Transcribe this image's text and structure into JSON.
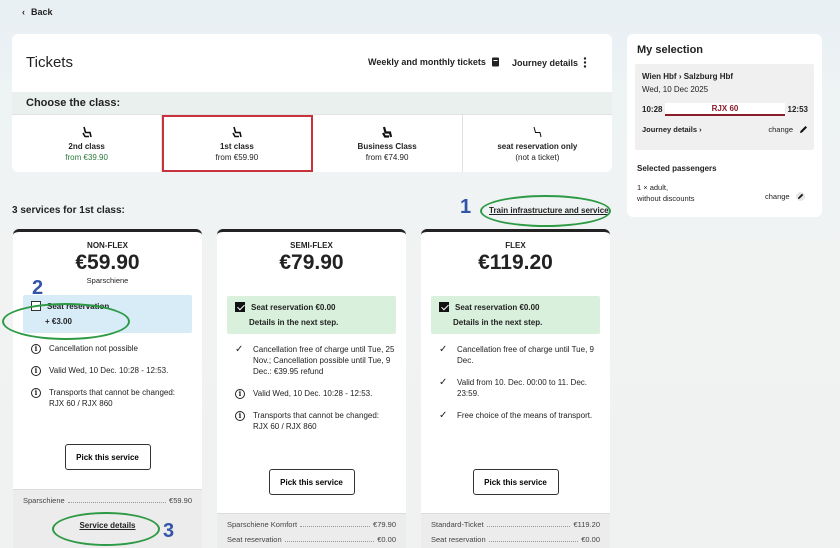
{
  "nav": {
    "back_label": "Back"
  },
  "header": {
    "title": "Tickets",
    "weekly_label": "Weekly and monthly tickets",
    "journey_label": "Journey details",
    "choose_class": "Choose the class:"
  },
  "classes": [
    {
      "name": "2nd class",
      "price": "from €39.90"
    },
    {
      "name": "1st class",
      "price": "from €59.90"
    },
    {
      "name": "Business Class",
      "price": "from €74.90"
    },
    {
      "name": "seat reservation only",
      "price": "(not a ticket)"
    }
  ],
  "services": {
    "heading": "3 services for 1st class:",
    "infra_link": "Train infrastructure and service",
    "annotations": [
      "1",
      "2",
      "3"
    ],
    "cards": [
      {
        "name": "NON-FLEX",
        "price": "€59.90",
        "sub": "Sparschiene",
        "reservation": "Seat reservation",
        "reservation_sub": "+ €3.00",
        "features": [
          "Cancellation not possible",
          "Valid Wed, 10 Dec. 10:28 - 12:53.",
          "Transports that cannot be changed: RJX 60 / RJX 860"
        ],
        "pick": "Pick this service",
        "foot": [
          {
            "label": "Sparschiene",
            "value": "€59.90"
          }
        ],
        "details": "Service details"
      },
      {
        "name": "SEMI-FLEX",
        "price": "€79.90",
        "sub": "",
        "reservation": "Seat reservation €0.00",
        "reservation_sub": "Details in the next step.",
        "features": [
          "Cancellation free of charge until Tue, 25 Nov.; Cancellation possible until Tue, 9 Dec.: €39.95 refund",
          "Valid Wed, 10 Dec. 10:28 - 12:53.",
          "Transports that cannot be changed: RJX 60 / RJX 860"
        ],
        "pick": "Pick this service",
        "foot": [
          {
            "label": "Sparschiene Komfort",
            "value": "€79.90"
          },
          {
            "label": "Seat reservation",
            "value": "€0.00"
          }
        ]
      },
      {
        "name": "FLEX",
        "price": "€119.20",
        "sub": "",
        "reservation": "Seat reservation €0.00",
        "reservation_sub": "Details in the next step.",
        "features": [
          "Cancellation free of charge until Tue, 9 Dec.",
          "Valid from 10. Dec. 00:00 to 11. Dec. 23:59.",
          "Free choice of the means of transport."
        ],
        "pick": "Pick this service",
        "foot": [
          {
            "label": "Standard-Ticket",
            "value": "€119.20"
          },
          {
            "label": "Seat reservation",
            "value": "€0.00"
          }
        ]
      }
    ]
  },
  "selection": {
    "title": "My selection",
    "route": "Wien Hbf › Salzburg Hbf",
    "date": "Wed, 10 Dec 2025",
    "dep": "10:28",
    "train": "RJX 60",
    "arr": "12:53",
    "journey_details": "Journey details ›",
    "change": "change",
    "passengers_heading": "Selected passengers",
    "passengers_line1": "1 × adult,",
    "passengers_line2": "without discounts"
  },
  "colors": {
    "accent_red": "#c8323a",
    "annotation_green": "#2d9a45",
    "annotation_blue": "#3355a8"
  }
}
